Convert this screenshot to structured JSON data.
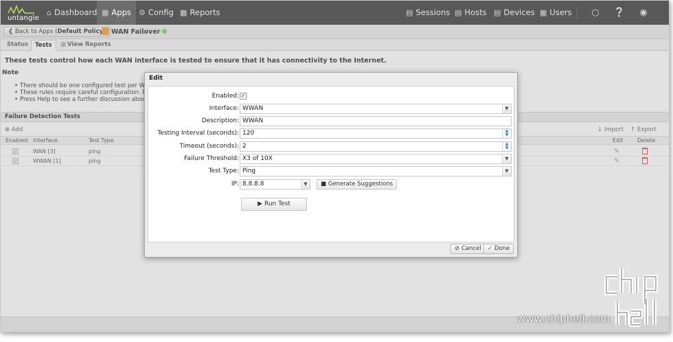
{
  "topnav": {
    "logo_text": "untangle",
    "items": [
      {
        "label": "Dashboard",
        "icon": "home-icon"
      },
      {
        "label": "Apps",
        "icon": "grid-icon",
        "active": true
      },
      {
        "label": "Config",
        "icon": "gear-icon"
      },
      {
        "label": "Reports",
        "icon": "chart-icon"
      }
    ],
    "right_items": [
      {
        "label": "Sessions",
        "icon": "sessions-icon"
      },
      {
        "label": "Hosts",
        "icon": "hosts-icon"
      },
      {
        "label": "Devices",
        "icon": "devices-icon"
      },
      {
        "label": "Users",
        "icon": "users-icon"
      }
    ],
    "icons": [
      "lightbulb-icon",
      "help-icon",
      "account-icon"
    ]
  },
  "breadcrumb": {
    "back_prefix": "Back to Apps (",
    "back_policy": "Default Policy",
    "back_suffix": ")",
    "app_name": "WAN Failover"
  },
  "tabs": [
    "Status",
    "Tests",
    "View Reports"
  ],
  "content": {
    "description": "These tests control how each WAN interface is tested to ensure that it has connectivity to the Internet.",
    "note_heading": "Note",
    "notes": [
      "There should be one configured test per WAN",
      "These rules require careful configuration. Poo",
      "Press Help to see a further discussion about f"
    ],
    "section_title": "Failure Detection Tests",
    "toolbar": {
      "add": "Add",
      "import": "Import",
      "export": "Export"
    },
    "columns": [
      "Enabled",
      "Interface",
      "Test Type",
      "Edit",
      "Delete"
    ],
    "rows": [
      {
        "interface": "WAN [3]",
        "test_type": "ping",
        "enabled": true
      },
      {
        "interface": "WWAN [1]",
        "test_type": "ping",
        "enabled": true
      }
    ]
  },
  "dialog": {
    "title": "Edit",
    "fields": {
      "enabled_label": "Enabled:",
      "enabled": true,
      "interface_label": "Interface:",
      "interface_value": "WWAN",
      "description_label": "Description:",
      "description_value": "WWAN",
      "interval_label": "Testing Interval (seconds):",
      "interval_value": "120",
      "timeout_label": "Timeout (seconds):",
      "timeout_value": "2",
      "threshold_label": "Failure Threshold:",
      "threshold_value": "X3 of 10X",
      "test_type_label": "Test Type:",
      "test_type_value": "Ping",
      "ip_label": "IP:",
      "ip_value": "8.8.8.8"
    },
    "generate_label": "Generate Suggestions",
    "run_test_label": "Run Test",
    "cancel_label": "Cancel",
    "done_label": "Done"
  },
  "watermark": {
    "text": "www.chiphell.com"
  },
  "colors": {
    "nav_bg": "#585858",
    "accent_green": "#7fcf6a",
    "delete_red": "#d9534f",
    "spin_blue": "#3a7fc2"
  }
}
